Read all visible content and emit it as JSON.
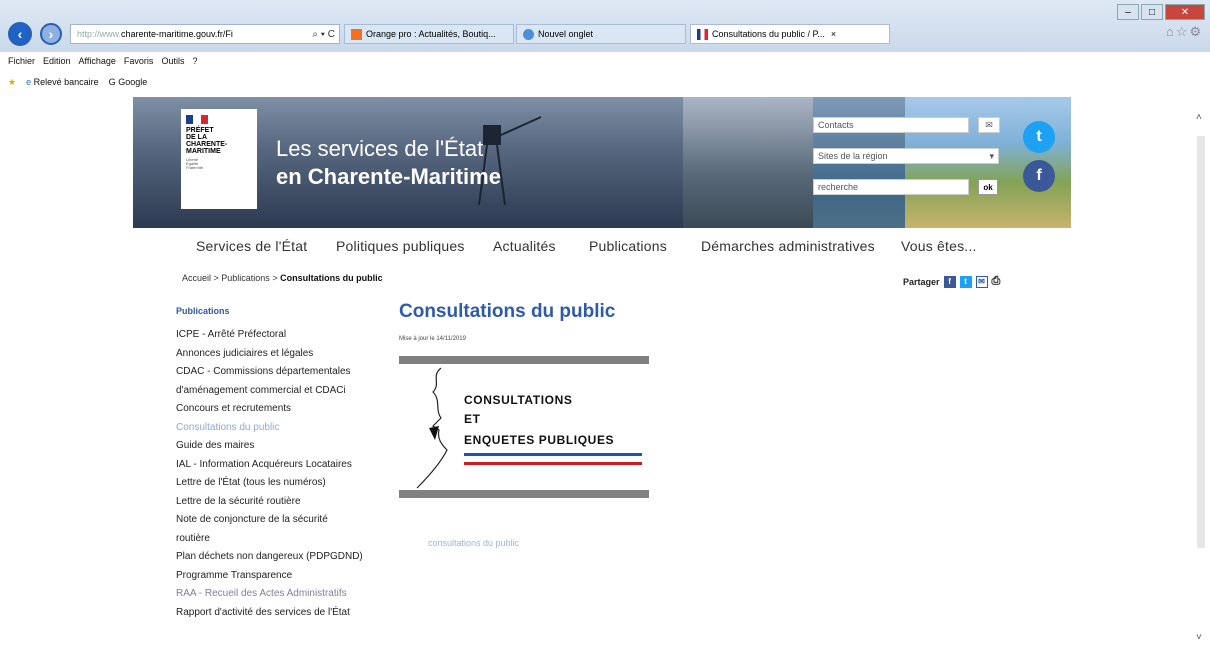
{
  "browser": {
    "address_proto": "http://www.",
    "address_host": "charente-maritime.gouv.fr",
    "address_suffix": "/Fi",
    "address_controls": "⌕ ▾ C",
    "tabs": [
      {
        "label": "Orange pro : Actualités, Boutiq..."
      },
      {
        "label": "Nouvel onglet"
      },
      {
        "label": "Consultations du public / P...",
        "close": "×"
      }
    ],
    "menu": [
      "Fichier",
      "Edition",
      "Affichage",
      "Favoris",
      "Outils",
      "?"
    ],
    "favorites": [
      "Relevé bancaire",
      "Google"
    ],
    "icons": [
      "back-arrow-icon",
      "forward-arrow-icon",
      "home-icon",
      "star-icon",
      "gear-icon"
    ]
  },
  "banner": {
    "logo_text": "PRÉFET\nDE LA\nCHARENTE-\nMARITIME",
    "logo_motto": "Liberté\nÉgalité\nFraternité",
    "title_line1": "Les services de l'État",
    "title_line2": "en Charente-Maritime",
    "contacts_placeholder": "Contacts",
    "region_select": "Sites de la région",
    "search_placeholder": "recherche",
    "ok_label": "ok"
  },
  "nav": {
    "items": [
      "Services de l'État",
      "Politiques publiques",
      "Actualités",
      "Publications",
      "Démarches administratives",
      "Vous êtes..."
    ]
  },
  "breadcrumb": {
    "home": "Accueil",
    "section": "Publications",
    "current": "Consultations du public",
    "sep": " > "
  },
  "share": {
    "label": "Partager"
  },
  "sidebar": {
    "title": "Publications",
    "items": [
      "ICPE - Arrêté Préfectoral",
      "Annonces judiciaires et légales",
      "CDAC - Commissions départementales",
      "d'aménagement commercial et CDACi",
      "Concours et recrutements",
      "Consultations du public",
      "Guide des maires",
      "IAL - Information Acquéreurs Locataires",
      "Lettre de l'État (tous les numéros)",
      "Lettre de la sécurité routière",
      "Note de conjoncture de la sécurité",
      "routière",
      "Plan déchets non dangereux (PDPGDND)",
      "Programme Transparence",
      "RAA - Recueil des Actes Administratifs",
      "Rapport d'activité des services de l'État"
    ],
    "active_index": 5
  },
  "content": {
    "title": "Consultations du public",
    "updated": "Mise à jour le 14/11/2019",
    "image_lines": [
      "CONSULTATIONS",
      "ET",
      "ENQUETES PUBLIQUES"
    ],
    "link_text": "consultations du public"
  },
  "colors": {
    "accent": "#2f5aa8",
    "flag_blue": "#1b3d8c",
    "flag_red": "#d8272f",
    "twitter": "#1da1f2",
    "facebook": "#3b5998"
  }
}
